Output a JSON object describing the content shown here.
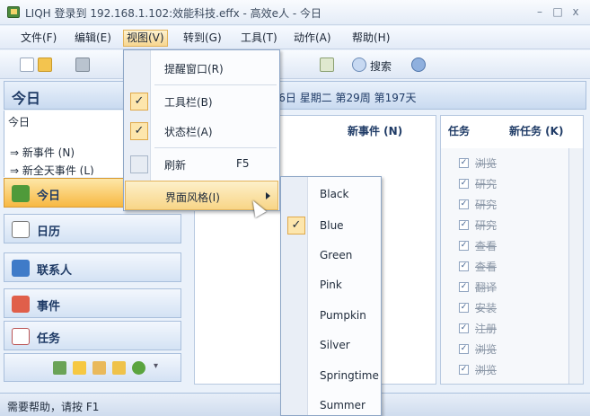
{
  "window": {
    "title": "LIQH 登录到 192.168.1.102:效能科技.effx - 高效e人 - 今日",
    "min_glyph": "–",
    "max_glyph": "□",
    "close_glyph": "x"
  },
  "menubar": [
    "文件(F)",
    "编辑(E)",
    "视图(V)",
    "转到(G)",
    "工具(T)",
    "动作(A)",
    "帮助(H)"
  ],
  "toolbar": {
    "search_label": "搜索"
  },
  "left_pane": {
    "header": "今日",
    "sub_title": "今日",
    "links": [
      "⇒ 新事件 (N)",
      "⇒ 新全天事件 (L)"
    ],
    "nav": [
      "今日",
      "日历",
      "联系人",
      "事件",
      "任务"
    ]
  },
  "main": {
    "date_text": "7月16日 星期二  第29周 第197天",
    "events_header": "新事件 (N)",
    "tasks_label": "任务",
    "new_task_label": "新任务 (K)",
    "tasks": [
      "浏览",
      "研究",
      "研究",
      "研究",
      "查看",
      "查看",
      "翻译",
      "安装",
      "注册",
      "浏览",
      "浏览"
    ]
  },
  "status": {
    "text": "需要帮助，请按 F1"
  },
  "view_menu": {
    "items": [
      {
        "label": "提醒窗口(R)",
        "checked": false,
        "accel": ""
      },
      {
        "label": "工具栏(B)",
        "checked": true,
        "accel": ""
      },
      {
        "label": "状态栏(A)",
        "checked": true,
        "accel": ""
      },
      {
        "label": "刷新",
        "checked": false,
        "accel": "F5"
      },
      {
        "label": "界面风格(I)",
        "checked": false,
        "accel": "",
        "submenu": true
      }
    ],
    "check_glyph": "✓"
  },
  "style_menu": {
    "items": [
      "Black",
      "Blue",
      "Green",
      "Pink",
      "Pumpkin",
      "Silver",
      "Springtime",
      "Summer"
    ],
    "selected": "Blue"
  },
  "colors": {
    "accent": "#f7b842",
    "header_blue": "#1f3b66",
    "menu_highlight": "#f8d587"
  }
}
